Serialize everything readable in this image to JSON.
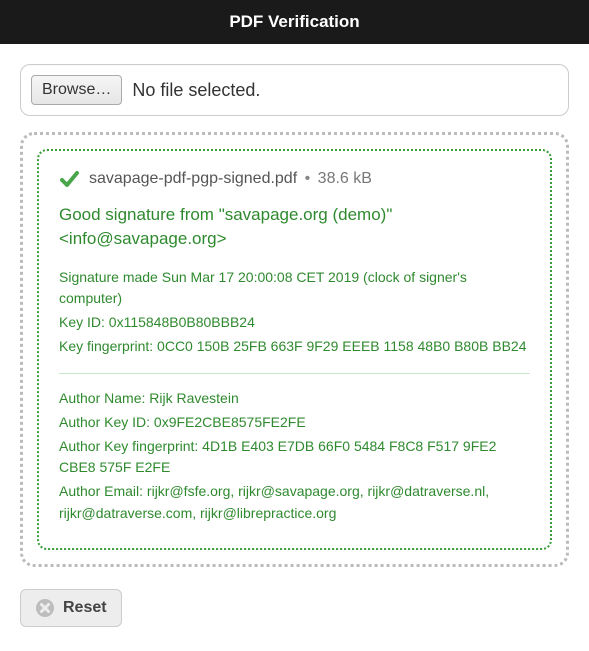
{
  "title": "PDF Verification",
  "file_picker": {
    "browse_label": "Browse…",
    "status": "No file selected."
  },
  "result": {
    "file_name": "savapage-pdf-pgp-signed.pdf",
    "file_size": "38.6 kB",
    "good_signature": "Good signature from \"savapage.org (demo)\" <info@savapage.org>",
    "signature_made": "Signature made Sun Mar 17 20:00:08 CET 2019 (clock of signer's computer)",
    "key_id": "Key ID: 0x115848B0B80BBB24",
    "key_fingerprint": "Key fingerprint: 0CC0 150B 25FB 663F 9F29 EEEB 1158 48B0 B80B BB24",
    "author_name": "Author Name: Rijk Ravestein",
    "author_key_id": "Author Key ID: 0x9FE2CBE8575FE2FE",
    "author_key_fingerprint": "Author Key fingerprint: 4D1B E403 E7DB 66F0 5484 F8C8 F517 9FE2 CBE8 575F E2FE",
    "author_email": "Author Email: rijkr@fsfe.org, rijkr@savapage.org, rijkr@datraverse.nl, rijkr@datraverse.com, rijkr@librepractice.org"
  },
  "reset_label": "Reset",
  "bullet": "•"
}
